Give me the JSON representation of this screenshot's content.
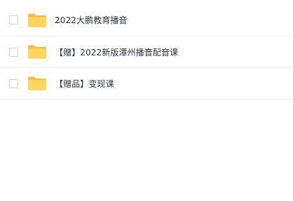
{
  "files": [
    {
      "name": "2022大鹏教育播音",
      "type": "folder",
      "checked": false
    },
    {
      "name": "【赠】2022新版潭州播音配音课",
      "type": "folder",
      "checked": false
    },
    {
      "name": "【赠品】变现课",
      "type": "folder",
      "checked": false
    }
  ],
  "icons": {
    "folder": "folder-icon",
    "checkbox": "checkbox"
  },
  "colors": {
    "folder_body": "#FFD45F",
    "folder_tab": "#F5BE3F",
    "divider": "#F0F0F2",
    "text": "#2F3540"
  }
}
